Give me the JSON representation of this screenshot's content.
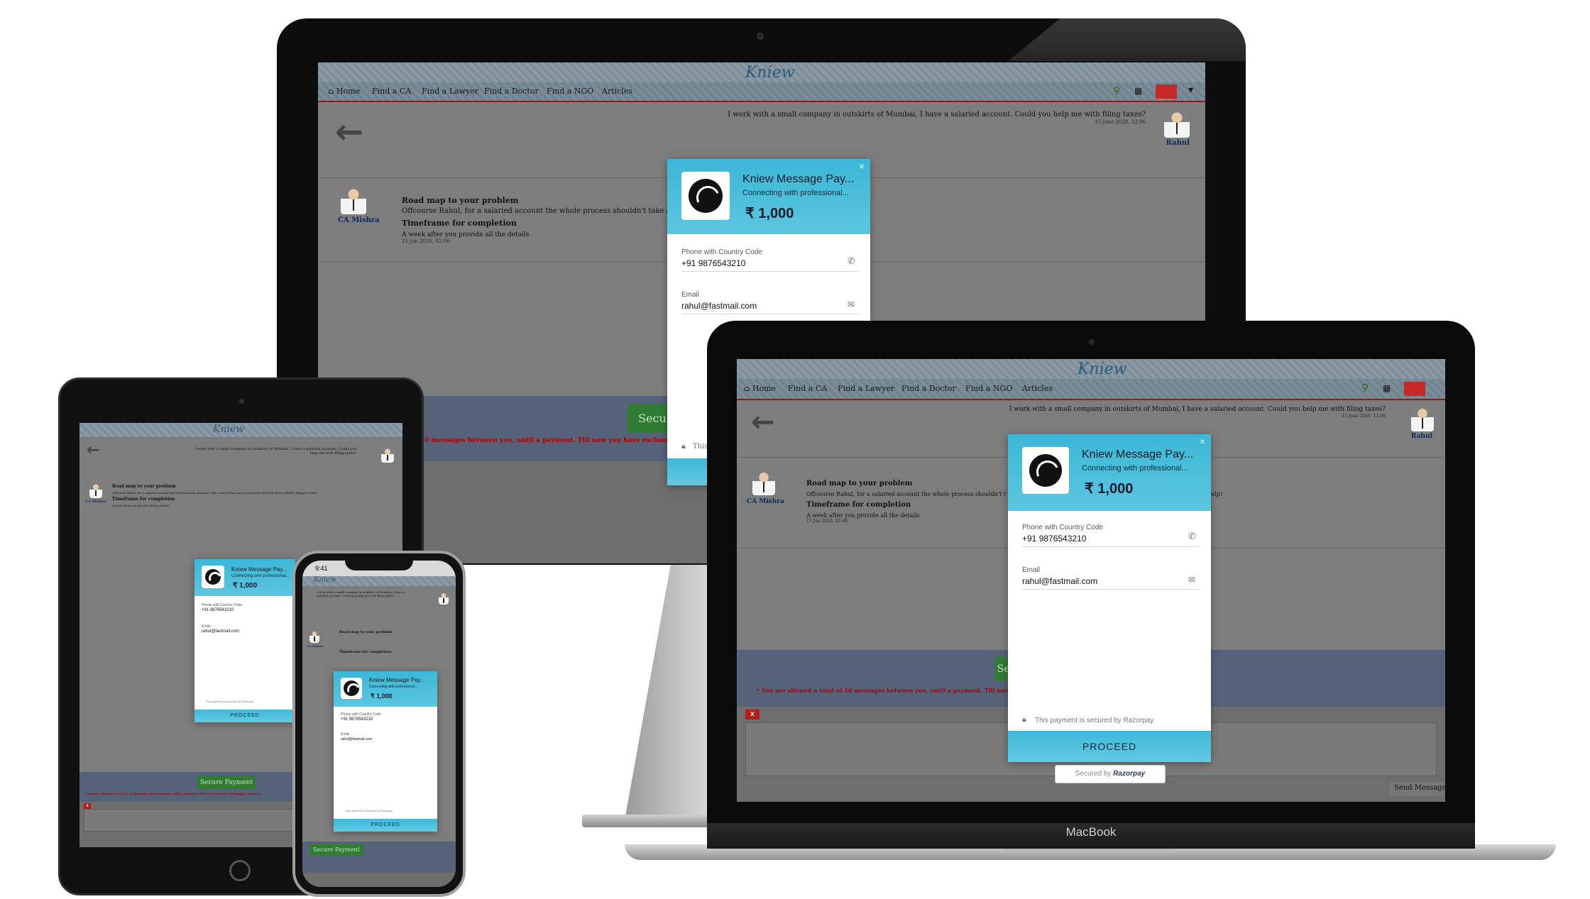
{
  "site": {
    "logo_text": "Kniew",
    "nav": [
      "Home",
      "Find a CA",
      "Find a Lawyer",
      "Find a Doctor",
      "Find a NGO",
      "Articles"
    ]
  },
  "conversation": {
    "question": "I work with a small company in outskirts of Mumbai, I have a salaried account. Could you help me with filing taxes?",
    "question_time": "15 June 2020, 12:06",
    "asker_name": "Rahul",
    "responder_name": "CA Mishra",
    "answer_title": "Road map to your problem",
    "answer_body": "Offcourse Rahul, for a salaried account the whole process shouldn't take a lot of time once you provide me with all the details. Happy to help!",
    "answer_body_short_imac": "Offcourse Rahul, for a salaried account the whole process shouldn't take a lot of time once y",
    "answer_body_short_mac": "Offcourse Rahul, for a salaried account the whole process shouldn't t",
    "answer_tail_mac": "o help!",
    "timeframe_title": "Timeframe for completion",
    "timeframe_body": "A week after you provide all the details",
    "answer_time": "15 Jun 2020, 02:06"
  },
  "payment_bar": {
    "secure_button": "Secure Payment",
    "secure_button_short": "Secu",
    "warning": "* You are allowed a total of 10 messages between you, until a payment. Till now you have exchanged a total of",
    "warning_imac": "0 messages between you, until a payment. Till now you have exchanged a total of",
    "warning_mac": "* You are allowed a total of 10 messages between you, until a payment. Till now yo",
    "close_icon_text": "x",
    "send_button": "Send Message"
  },
  "razorpay": {
    "merchant": "Kniew Message Pay...",
    "subtitle": "Connecting with professional...",
    "amount": "₹ 1,000",
    "phone_label": "Phone with Country Code",
    "phone_value": "+91 9876543210",
    "email_label": "Email",
    "email_value": "rahul@fastmail.com",
    "secured_note": "This payment is secured by Razorpay.",
    "secured_note_short": "This",
    "proceed": "PROCEED",
    "badge_prefix": "Secured by",
    "badge_brand": "Razorpay",
    "close": "×"
  },
  "devices": {
    "laptop_brand": "MacBook",
    "phone_time": "9:41"
  }
}
